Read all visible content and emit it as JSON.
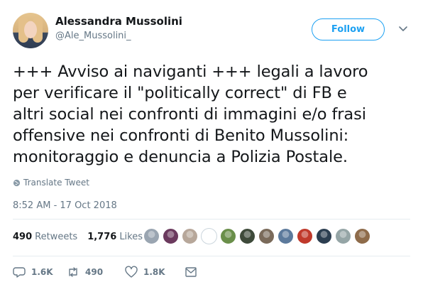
{
  "user": {
    "display_name": "Alessandra Mussolini",
    "handle": "@Ale_Mussolini_",
    "follow_label": "Follow"
  },
  "tweet": {
    "text": "+++ Avviso ai naviganti +++ legali a lavoro\nper verificare il \"politically correct\" di FB e\naltri social nei confronti di immagini e/o frasi\noffensive nei confronti di Benito Mussolini:\nmonitoraggio e denuncia a Polizia Postale.",
    "translate_label": "Translate Tweet",
    "timestamp": "8:52 AM - 17 Oct 2018"
  },
  "stats": {
    "retweets_count": "490",
    "retweets_label": "Retweets",
    "likes_count": "1,776",
    "likes_label": "Likes"
  },
  "liker_avatar_colors": [
    "#9aa5b1",
    "#6b3a5e",
    "#b7a79a",
    "#ffffff",
    "#6a8f4a",
    "#3e4a3a",
    "#7a6a5a",
    "#5c7a9c",
    "#c0392b",
    "#2c3e50",
    "#95a5a6",
    "#8e6b4a"
  ],
  "actions": {
    "reply_count": "1.6K",
    "retweet_count": "490",
    "like_count": "1.8K"
  },
  "colors": {
    "accent": "#1da1f2",
    "muted": "#657786",
    "text": "#14171a",
    "divider": "#e6ecf0"
  },
  "icons": [
    "chevron-down-icon",
    "globe-icon",
    "reply-icon",
    "retweet-icon",
    "heart-icon",
    "message-icon"
  ]
}
